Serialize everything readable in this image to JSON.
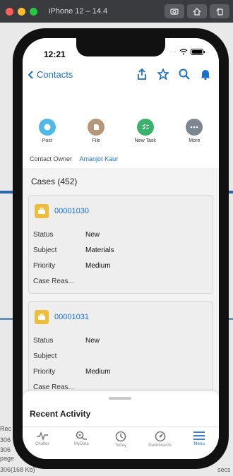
{
  "simulator": {
    "title": "iPhone 12 – 14.4"
  },
  "status": {
    "time": "12:21"
  },
  "nav": {
    "back_label": "Contacts"
  },
  "actions": [
    {
      "label": "Post",
      "color": "#4fb8e6"
    },
    {
      "label": "File",
      "color": "#b49679"
    },
    {
      "label": "New Task",
      "color": "#3bb26a"
    },
    {
      "label": "More",
      "color": "#7d8792"
    }
  ],
  "contact": {
    "owner_label": "Contact Owner",
    "owner_name": "Amanjot Kaur"
  },
  "cases_section": {
    "title": "Cases (452)"
  },
  "cases": [
    {
      "number": "00001030",
      "fields": [
        {
          "label": "Status",
          "value": "New"
        },
        {
          "label": "Subject",
          "value": "Materials"
        },
        {
          "label": "Priority",
          "value": "Medium"
        },
        {
          "label": "Case Reas...",
          "value": ""
        }
      ]
    },
    {
      "number": "00001031",
      "fields": [
        {
          "label": "Status",
          "value": "New"
        },
        {
          "label": "Subject",
          "value": ""
        },
        {
          "label": "Priority",
          "value": "Medium"
        },
        {
          "label": "Case Reas...",
          "value": ""
        }
      ]
    }
  ],
  "recent": {
    "title": "Recent Activity"
  },
  "tabs": [
    {
      "label": "Chatter",
      "icon": "chatter-icon"
    },
    {
      "label": "MyData",
      "icon": "mydata-icon"
    },
    {
      "label": "Today",
      "icon": "clock-icon"
    },
    {
      "label": "Dashboards",
      "icon": "gauge-icon"
    },
    {
      "label": "Menu",
      "icon": "menu-icon"
    }
  ],
  "background": {
    "left_snippets": [
      "Rec",
      "306",
      "306",
      "page",
      "306(168 Kb)"
    ],
    "right_snippet": "secs"
  },
  "colors": {
    "link": "#1b6fc9",
    "case_icon": "#eebd3a",
    "tab_active": "#1b6fc9"
  }
}
